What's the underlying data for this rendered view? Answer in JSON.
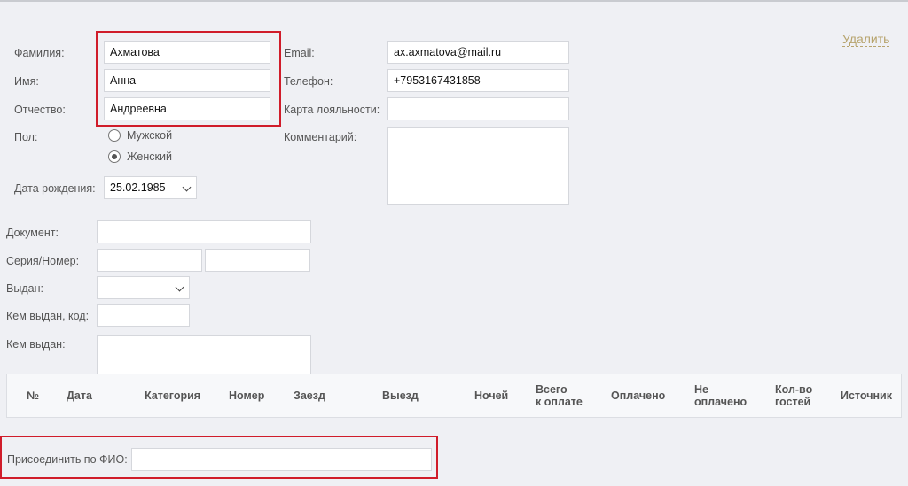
{
  "actions": {
    "delete_label": "Удалить"
  },
  "person": {
    "last_name_label": "Фамилия:",
    "last_name_value": "Ахматова",
    "first_name_label": "Имя:",
    "first_name_value": "Анна",
    "patronymic_label": "Отчество:",
    "patronymic_value": "Андреевна",
    "gender_label": "Пол:",
    "gender_options": [
      "Мужской",
      "Женский"
    ],
    "gender_selected": "Женский",
    "birth_label": "Дата рождения:",
    "birth_value": "25.02.1985"
  },
  "contact": {
    "email_label": "Email:",
    "email_value": "ax.axmatova@mail.ru",
    "phone_label": "Телефон:",
    "phone_value": "+7953167431858",
    "loyalty_label": "Карта лояльности:",
    "loyalty_value": "",
    "comment_label": "Комментарий:",
    "comment_value": ""
  },
  "document": {
    "doc_label": "Документ:",
    "doc_value": "",
    "series_label": "Серия/Номер:",
    "series_value": "",
    "number_value": "",
    "issued_label": "Выдан:",
    "issued_value": "",
    "issuer_code_label": "Кем выдан, код:",
    "issuer_code_value": "",
    "issuer_label": "Кем выдан:",
    "issuer_value": ""
  },
  "table": {
    "columns": [
      [
        "№",
        ""
      ],
      [
        "Дата",
        ""
      ],
      [
        "Категория",
        ""
      ],
      [
        "Номер",
        ""
      ],
      [
        "Заезд",
        ""
      ],
      [
        "Выезд",
        ""
      ],
      [
        "Ночей",
        ""
      ],
      [
        "Всего",
        "к оплате"
      ],
      [
        "Оплачено",
        ""
      ],
      [
        "Не",
        "оплачено"
      ],
      [
        "Кол-во",
        "гостей"
      ],
      [
        "Источник",
        ""
      ]
    ]
  },
  "join": {
    "label": "Присоединить по ФИО:",
    "value": ""
  },
  "colors": {
    "highlight": "#d01c2a",
    "link": "#b7a46e",
    "background": "#eff0f4"
  }
}
